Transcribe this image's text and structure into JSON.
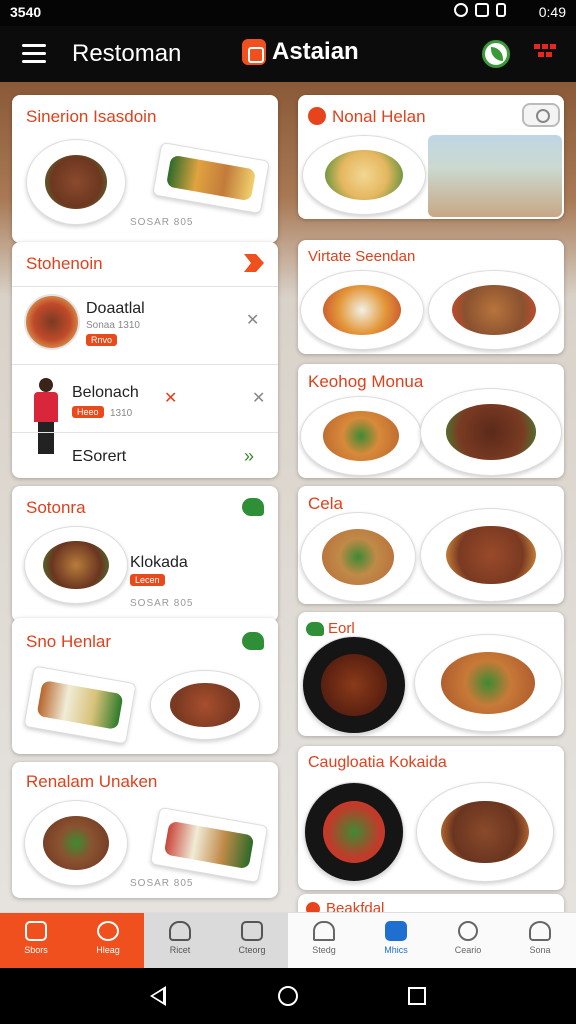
{
  "status": {
    "time": "3540",
    "clock": "0:49"
  },
  "appbar": {
    "title": "Restoman",
    "brand": "Astaian"
  },
  "left": {
    "card1": {
      "title": "Sinerion Isasdoin",
      "price": "SOSAR 805"
    },
    "card2": {
      "title": "Stohenoin",
      "rows": [
        {
          "name": "Doaatlal",
          "sub": "Sonaa 1310",
          "tag": "Rnvo"
        },
        {
          "name": "Belonach",
          "tag": "Heeo",
          "sub": "1310"
        },
        {
          "name": "ESorert"
        }
      ]
    },
    "card3": {
      "title": "Sotonra",
      "item": "Klokada",
      "tag": "Lecen",
      "price": "SOSAR 805"
    },
    "card4": {
      "title": "Sno Henlar"
    },
    "card5": {
      "title": "Renalam Unaken",
      "price": "SOSAR 805"
    }
  },
  "right": {
    "card1": {
      "title": "Nonal Helan"
    },
    "card2": {
      "title": "Virtate Seendan"
    },
    "card3": {
      "title": "Keohog Monua"
    },
    "card4": {
      "title": "Cela"
    },
    "card5": {
      "title": "Eorl"
    },
    "card6": {
      "title": "Caugloatia Kokaida"
    },
    "card7": {
      "title": "Beakfdal"
    }
  },
  "nav": [
    {
      "label": "Sbors",
      "icon": "home-icon"
    },
    {
      "label": "Hleag",
      "icon": "basket-icon"
    },
    {
      "label": "Ricet",
      "icon": "dish-icon"
    },
    {
      "label": "Cteorg",
      "icon": "calendar-icon"
    },
    {
      "label": "Stedg",
      "icon": "tray-icon"
    },
    {
      "label": "Mhics",
      "icon": "store-icon"
    },
    {
      "label": "Ceario",
      "icon": "search-icon"
    },
    {
      "label": "Sona",
      "icon": "user-icon"
    }
  ],
  "colors": {
    "accent": "#f0501e",
    "green": "#3a8a2e",
    "text_orange": "#e0411c"
  }
}
